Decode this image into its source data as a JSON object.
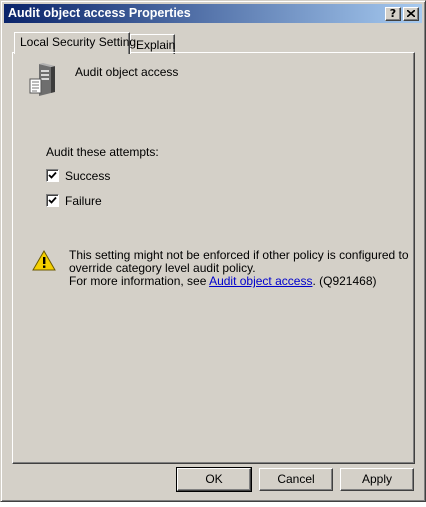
{
  "window": {
    "title": "Audit object access Properties",
    "help_label": "?"
  },
  "tabs": [
    {
      "label": "Local Security Setting",
      "active": true
    },
    {
      "label": "Explain",
      "active": false
    }
  ],
  "policy": {
    "icon": "server-icon",
    "name": "Audit object access"
  },
  "audit": {
    "label": "Audit these attempts:",
    "options": [
      {
        "label": "Success",
        "checked": true
      },
      {
        "label": "Failure",
        "checked": true
      }
    ]
  },
  "warning": {
    "icon": "warning-icon",
    "line1": "This setting might not be enforced if other policy is configured to",
    "line2": "override category level audit policy.",
    "line3_prefix": "For more information, see ",
    "link_text": "Audit object access",
    "line3_suffix": ". (Q921468)"
  },
  "buttons": {
    "ok": "OK",
    "cancel": "Cancel",
    "apply": "Apply"
  },
  "colors": {
    "titlebar_start": "#0a246a",
    "titlebar_end": "#a6caf0",
    "dialog_bg": "#d4d0c8",
    "link": "#0000cc"
  }
}
